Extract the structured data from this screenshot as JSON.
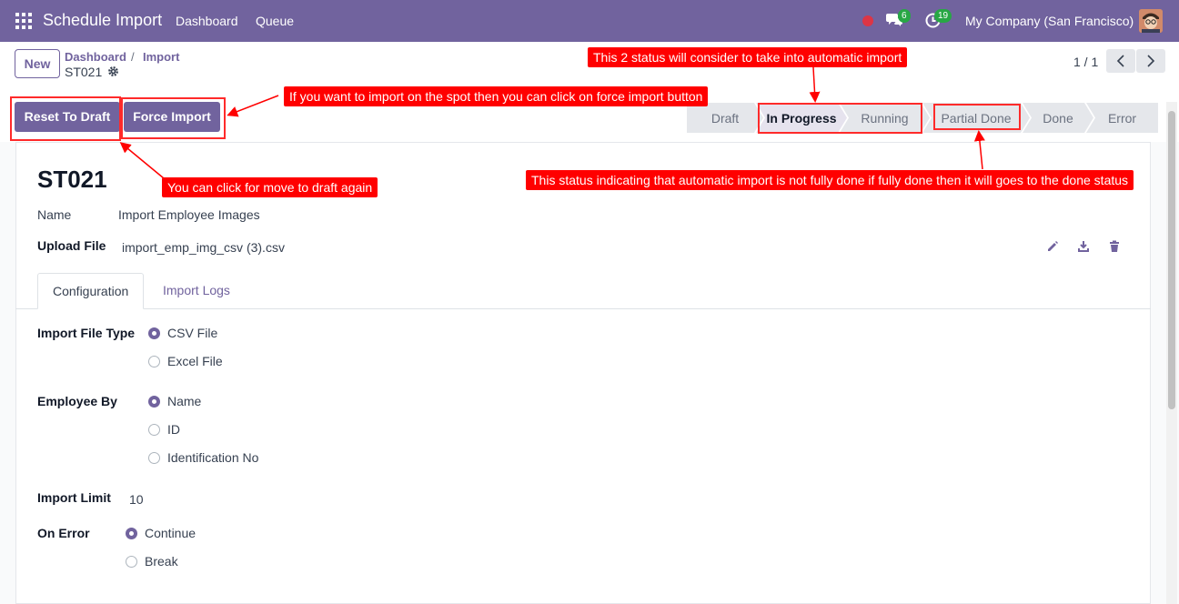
{
  "navbar": {
    "app_title": "Schedule Import",
    "links": [
      "Dashboard",
      "Queue"
    ],
    "chat_count": "6",
    "activity_count": "19",
    "company": "My Company (San Francisco)"
  },
  "control": {
    "new_label": "New",
    "breadcrumb": {
      "dashboard": "Dashboard",
      "separator": "/",
      "import": "Import",
      "record": "ST021"
    },
    "pager": "1 / 1"
  },
  "actions": {
    "reset_label": "Reset To Draft",
    "force_label": "Force Import"
  },
  "stages": [
    "Draft",
    "In Progress",
    "Running",
    "Partial Done",
    "Done",
    "Error"
  ],
  "stage_active": "In Progress",
  "record": {
    "title": "ST021",
    "name_label": "Name",
    "name_value": "Import Employee Images",
    "upload_label": "Upload File",
    "upload_value": "import_emp_img_csv (3).csv"
  },
  "tabs": [
    "Configuration",
    "Import Logs"
  ],
  "config": {
    "file_type_label": "Import File Type",
    "file_type_options": [
      "CSV File",
      "Excel File"
    ],
    "employee_by_label": "Employee By",
    "employee_by_options": [
      "Name",
      "ID",
      "Identification No"
    ],
    "limit_label": "Import Limit",
    "limit_value": "10",
    "on_error_label": "On Error",
    "on_error_options": [
      "Continue",
      "Break"
    ]
  },
  "annotations": {
    "status_note": "This 2 status will consider to take into automatic import",
    "force_note": "If you want to import on the spot then you can click on force import button",
    "draft_note": "You can click for move to draft again",
    "partial_note": "This status indicating that automatic import is not fully done if fully done then it will goes to the done status"
  },
  "colors": {
    "brand": "#71639e",
    "annotation": "#ff0000",
    "badge": "#28a745"
  }
}
